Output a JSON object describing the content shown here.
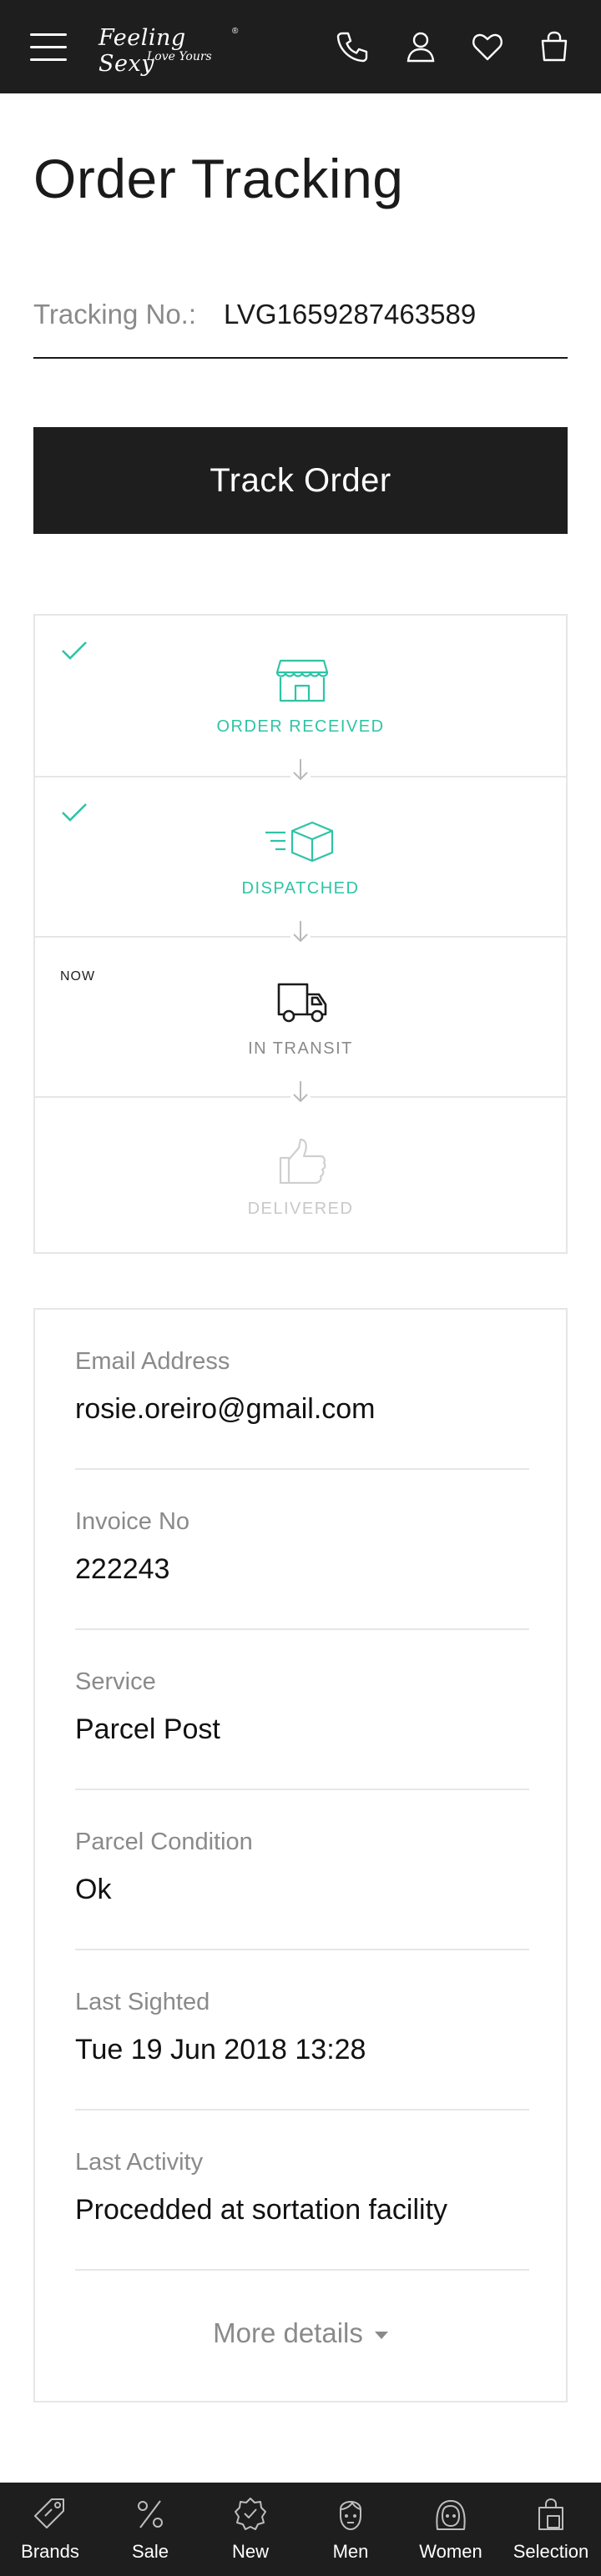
{
  "header": {
    "logo_text": "Feeling Sexy",
    "logo_tagline": "Love Yours",
    "logo_mark": "®",
    "icons": [
      "menu-icon",
      "phone-icon",
      "user-icon",
      "heart-icon",
      "bag-icon"
    ]
  },
  "page": {
    "title": "Order Tracking"
  },
  "tracking": {
    "label": "Tracking No.:",
    "value": "LVG1659287463589",
    "button_label": "Track Order"
  },
  "progress": {
    "steps": [
      {
        "label": "ORDER RECEIVED",
        "state": "done",
        "icon": "store-icon",
        "color": "#2ec4a6"
      },
      {
        "label": "DISPATCHED",
        "state": "done",
        "icon": "box-icon",
        "color": "#2ec4a6"
      },
      {
        "label": "IN TRANSIT",
        "state": "current",
        "icon": "truck-icon",
        "color": "#8a8a8a"
      },
      {
        "label": "DELIVERED",
        "state": "pending",
        "icon": "thumbs-up-icon",
        "color": "#c8c8c8"
      }
    ],
    "now_label": "NOW"
  },
  "details": {
    "rows": [
      {
        "label": "Email Address",
        "value": "rosie.oreiro@gmail.com"
      },
      {
        "label": "Invoice No",
        "value": "222243"
      },
      {
        "label": "Service",
        "value": "Parcel Post"
      },
      {
        "label": "Parcel Condition",
        "value": "Ok"
      },
      {
        "label": "Last Sighted",
        "value": "Tue 19 Jun 2018 13:28"
      },
      {
        "label": "Last Activity",
        "value": "Procedded at sortation facility"
      }
    ],
    "more_label": "More details"
  },
  "bottom_nav": {
    "items": [
      {
        "label": "Brands",
        "icon": "tag-icon"
      },
      {
        "label": "Sale",
        "icon": "percent-icon"
      },
      {
        "label": "New",
        "icon": "badge-icon"
      },
      {
        "label": "Men",
        "icon": "man-icon"
      },
      {
        "label": "Women",
        "icon": "woman-icon"
      },
      {
        "label": "Selection",
        "icon": "selection-bag-icon"
      }
    ]
  }
}
